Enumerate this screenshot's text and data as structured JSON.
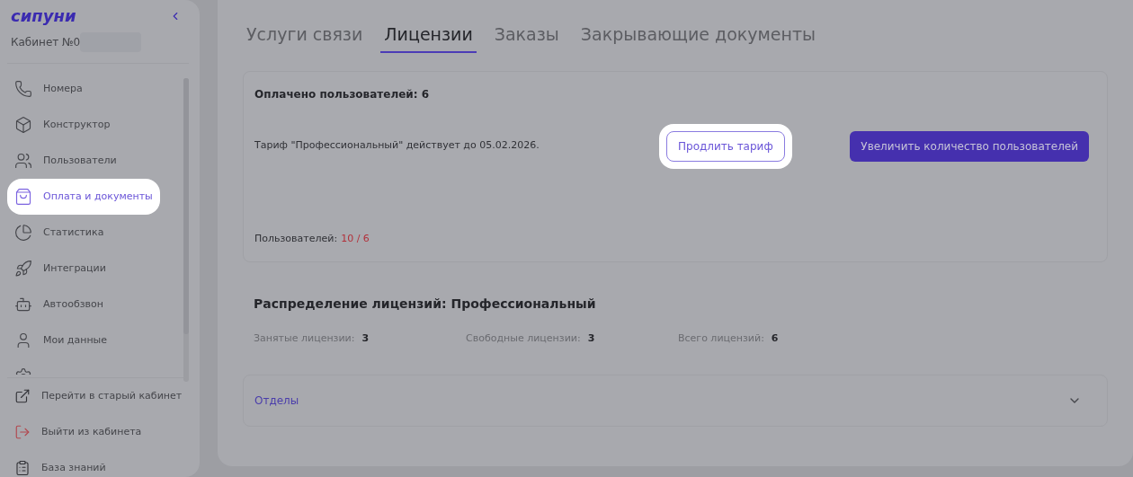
{
  "sidebar": {
    "logo": "сипуни",
    "account": "Кабинет №0",
    "items": [
      {
        "label": "Номера",
        "selected": false
      },
      {
        "label": "Конструктор",
        "selected": false
      },
      {
        "label": "Пользователи",
        "selected": false
      },
      {
        "label": "Оплата и документы",
        "selected": true
      },
      {
        "label": "Статистика",
        "selected": false
      },
      {
        "label": "Интеграции",
        "selected": false
      },
      {
        "label": "Автообзвон",
        "selected": false
      },
      {
        "label": "Мои данные",
        "selected": false
      },
      {
        "selected": false
      }
    ],
    "footer": [
      {
        "label": "Перейти в старый кабинет",
        "kind": "link"
      },
      {
        "label": "Выйти из кабинета",
        "kind": "danger"
      },
      {
        "label": "База знаний",
        "kind": "link"
      }
    ]
  },
  "tabs": [
    {
      "label": "Услуги связи",
      "selected": false
    },
    {
      "label": "Лицензии",
      "selected": true
    },
    {
      "label": "Заказы",
      "selected": false
    },
    {
      "label": "Закрывающие документы",
      "selected": false
    }
  ],
  "license_card": {
    "title": "Оплачено пользователей: 6",
    "tariff_text": "Тариф \"Профессиональный\" действует до 05.02.2026.",
    "extend_button": {
      "label": "Продлить тариф",
      "highlighted": true
    },
    "increase_button": {
      "label": "Увеличить количество пользователей",
      "highlighted": false
    },
    "users_label": "Пользователей:",
    "users_value": "10 / 6"
  },
  "distribution": {
    "title": "Распределение лицензий: Профессиональный",
    "stats": [
      {
        "label": "Занятые лицензии:",
        "value": "3"
      },
      {
        "label": "Свободные лицензии:",
        "value": "3"
      },
      {
        "label": "Всего лицензий:",
        "value": "6"
      }
    ],
    "departments": {
      "label": "Отделы",
      "expanded": false
    }
  }
}
